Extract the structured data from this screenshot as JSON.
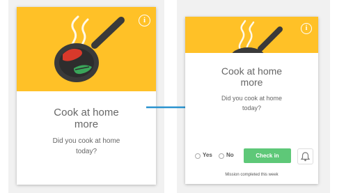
{
  "left_card": {
    "title_line1": "Cook at home",
    "title_line2": "more",
    "subtitle_line1": "Did you cook at home",
    "subtitle_line2": "today?",
    "info_icon": "info-icon",
    "illustration": "frying-pan-with-peppers"
  },
  "right_card": {
    "title_line1": "Cook at home",
    "title_line2": "more",
    "subtitle_line1": "Did you cook at home",
    "subtitle_line2": "today?",
    "info_icon": "info-icon",
    "illustration": "frying-pan",
    "options": {
      "yes_label": "Yes",
      "no_label": "No"
    },
    "checkin_label": "Check in",
    "bell_icon": "bell-icon",
    "status_text": "Mission completed this week"
  },
  "arrow_icon": "arrow-right-icon",
  "colors": {
    "banner": "#ffc127",
    "accent_green": "#5ec878",
    "arrow": "#2a93cf",
    "pan": "#3a3a3a",
    "pepper_red": "#d8392b",
    "pepper_green": "#3aa65a"
  }
}
